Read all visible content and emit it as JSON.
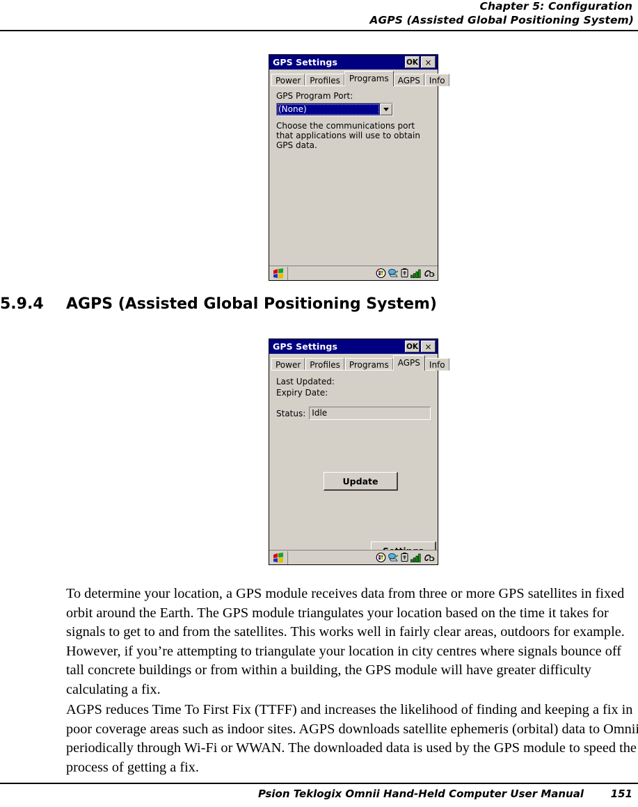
{
  "header": {
    "chapter": "Chapter 5: Configuration",
    "section": "AGPS (Assisted Global Positioning System)"
  },
  "section_heading": {
    "number": "5.9.4",
    "title": "AGPS (Assisted Global Positioning System)"
  },
  "colors": {
    "titlebar": "#000080",
    "dialog_face": "#d4d0c8",
    "selection": "#00008b",
    "signal_green": "#00a800"
  },
  "screenshot_programs": {
    "window_title": "GPS Settings",
    "ok_label": "OK",
    "close_label": "×",
    "tabs": [
      {
        "label": "Power",
        "active": false
      },
      {
        "label": "Profiles",
        "active": false
      },
      {
        "label": "Programs",
        "active": true
      },
      {
        "label": "AGPS",
        "active": false
      },
      {
        "label": "Info",
        "active": false
      }
    ],
    "port_label": "GPS Program Port:",
    "port_value": "(None)",
    "helper_text": "Choose the communications port that applications will use to obtain GPS data."
  },
  "screenshot_agps": {
    "window_title": "GPS Settings",
    "ok_label": "OK",
    "close_label": "×",
    "tabs": [
      {
        "label": "Power",
        "active": false
      },
      {
        "label": "Profiles",
        "active": false
      },
      {
        "label": "Programs",
        "active": false
      },
      {
        "label": "AGPS",
        "active": true
      },
      {
        "label": "Info",
        "active": false
      }
    ],
    "last_updated_label": "Last Updated:",
    "expiry_date_label": "Expiry Date:",
    "status_label": "Status:",
    "status_value": "Idle",
    "update_label": "Update",
    "settings_label": "Settings"
  },
  "taskbar": {
    "start_icon": "windows-start-flag-icon",
    "tray_icons": [
      "desktop-globe-icon",
      "network-connection-icon",
      "battery-icon",
      "signal-strength-icon",
      "plug-connect-icon"
    ]
  },
  "body": {
    "paragraph_1": "To determine your location, a GPS module receives data from three or more GPS satellites in fixed orbit around the Earth. The GPS module triangulates your location based on the time it takes for signals to get to and from the satellites. This works well in fairly clear areas, outdoors for example. However, if you’re attempting to triangulate your location in city centres where signals bounce off tall concrete buildings or from within a building, the GPS module will have greater difficulty calculating a fix.",
    "paragraph_2": "AGPS reduces Time To First Fix (TTFF) and increases the likelihood of finding and keeping a fix in poor coverage areas such as indoor sites. AGPS downloads satellite ephemeris (orbital) data to Omnii periodically through Wi-Fi or WWAN. The downloaded data is used by the GPS module to speed the process of getting a fix."
  },
  "footer": {
    "title": "Psion Teklogix Omnii Hand-Held Computer User Manual",
    "page": "151"
  }
}
